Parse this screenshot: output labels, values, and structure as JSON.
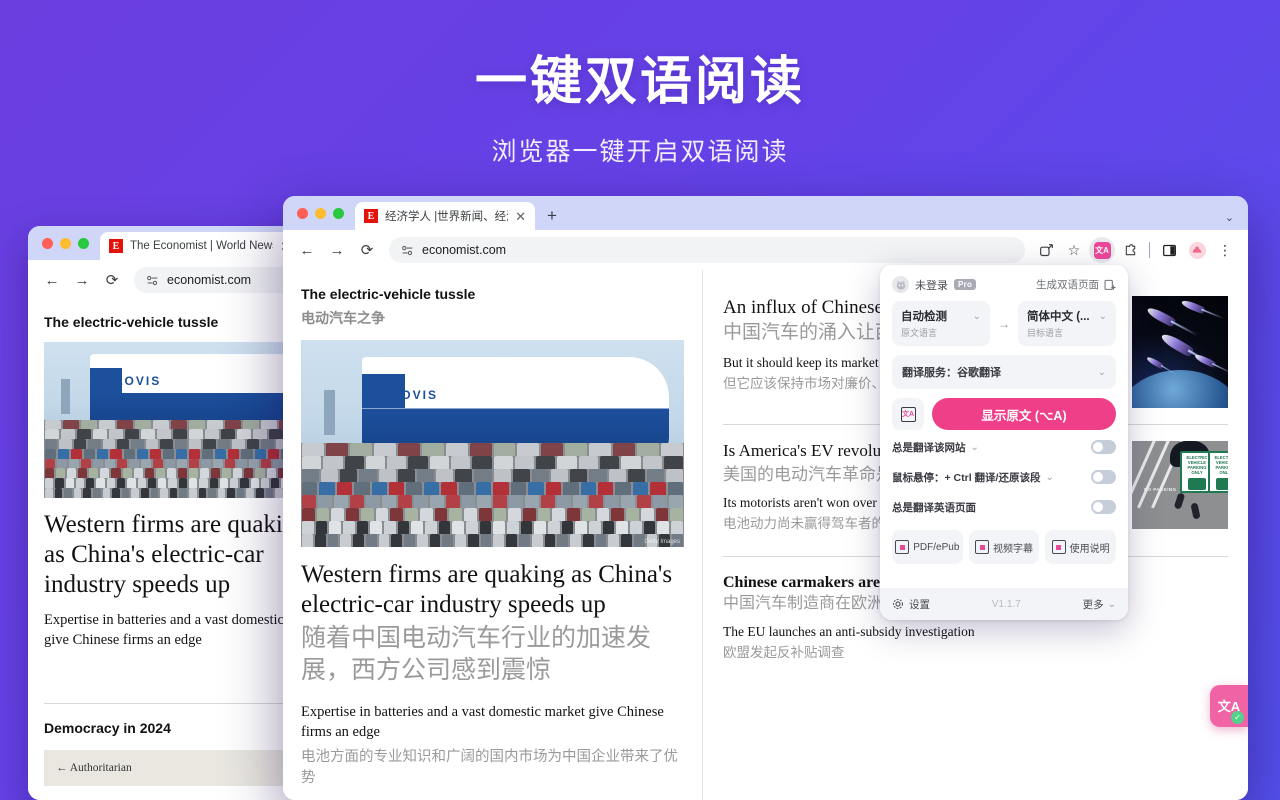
{
  "hero": {
    "title": "一键双语阅读",
    "subtitle": "浏览器一键开启双语阅读"
  },
  "back_window": {
    "tab": {
      "favicon_letter": "E",
      "title": "The Economist | World News,",
      "close": "✕"
    },
    "omnibox": {
      "url": "economist.com",
      "back": "←",
      "forward": "→",
      "reload": "⟳"
    },
    "page": {
      "kicker": "The electric-vehicle tussle",
      "headline": "Western firms are quaking as China's electric-car industry speeds up",
      "standfirst": "Expertise in batteries and a vast domestic market give Chinese firms an edge",
      "section_title": "Democracy in 2024",
      "chart_label": "← Authoritarian",
      "image_caption": "GLOVIS"
    }
  },
  "front_window": {
    "tab": {
      "favicon_letter": "E",
      "title": "经济学人 |世界新闻、经济、政",
      "close": "✕"
    },
    "newtab_label": "+",
    "window_chevron": "⌄",
    "omnibox": {
      "url": "economist.com",
      "back": "←",
      "forward": "→",
      "reload": "⟳"
    },
    "toolbar": {
      "share_icon": "⇪",
      "bookmark_icon": "☆",
      "extension_chip_label": "文A",
      "puzzle_icon": "⬗",
      "sidepanel_icon": "▥",
      "menu_icon": "⋮"
    },
    "left_column": {
      "kicker_en": "The electric-vehicle tussle",
      "kicker_zh": "电动汽车之争",
      "image_caption": "GLOVIS",
      "image_credit": "Getty Images",
      "headline_en": "Western firms are quaking as China's electric-car industry speeds up",
      "headline_zh": "随着中国电动汽车行业的加速发展，西方公司感到震惊",
      "standfirst_en": "Expertise in batteries and a vast domestic market give Chinese firms an edge",
      "standfirst_zh": "电池方面的专业知识和广阔的国内市场为中国企业带来了优势"
    },
    "right_column": {
      "stories": [
        {
          "headline_en": "An influx of Chinese cars is coming to the West",
          "headline_zh": "中国汽车的涌入让西方",
          "sub_en": "But it should keep its market open to cheap, green vehicles",
          "sub_zh": "但它应该保持市场对廉价、",
          "thumb": "space-cars"
        },
        {
          "headline_en": "Is America's EV revolution stalling?",
          "headline_zh": "美国的电动汽车革命是",
          "sub_en": "Its motorists aren't won over by battery power",
          "sub_zh": "电池动力尚未赢得驾车者的青睐",
          "thumb": "ev-parking"
        },
        {
          "headline_en": "Chinese carmakers are under scrutiny in Europe",
          "headline_zh": "中国汽车制造商在欧洲受到审查",
          "sub_en": "The EU launches an anti-subsidy investigation",
          "sub_zh": "欧盟发起反补贴调查",
          "thumb": null
        }
      ],
      "ev_sign_text": "ELECTRIC VEHICLE PARKING ONLY",
      "no_parking_text": "NO PARKING"
    },
    "floating_ball": {
      "glyph": "文A",
      "check": "✓"
    }
  },
  "popup": {
    "header": {
      "user_name": "未登录",
      "pro_badge": "Pro",
      "bilingual_page_action": "生成双语页面",
      "bilingual_page_icon": "⎘"
    },
    "source_lang": {
      "value": "自动检测",
      "label": "原文语言",
      "caret": "⌄"
    },
    "target_lang": {
      "value": "简体中文 (...",
      "label": "目标语言",
      "caret": "⌄"
    },
    "direction_arrow": "→",
    "service": {
      "label": "翻译服务：谷歌翻译",
      "caret": "⌄"
    },
    "swap_icon_label": "文A",
    "primary_button": "显示原文 (⌥A)",
    "options": [
      {
        "label": "总是翻译该网站",
        "caret": "⌄",
        "enabled": false
      },
      {
        "label": "鼠标悬停：+ Ctrl 翻译/还原该段",
        "caret": "⌄",
        "enabled": false
      },
      {
        "label": "总是翻译英语页面",
        "caret": "",
        "enabled": false
      }
    ],
    "quick_actions": [
      {
        "label": "PDF/ePub",
        "icon": "pdf-icon"
      },
      {
        "label": "视频字幕",
        "icon": "video-subtitle-icon"
      },
      {
        "label": "使用说明",
        "icon": "manual-icon"
      }
    ],
    "footer": {
      "settings_label": "设置",
      "settings_icon": "⚙",
      "version": "V1.1.7",
      "more_label": "更多",
      "more_caret": "⌄"
    }
  },
  "colors": {
    "brand_pink": "#ef3f88",
    "background_purple_start": "#6b3ee0",
    "background_purple_end": "#5551ee"
  }
}
